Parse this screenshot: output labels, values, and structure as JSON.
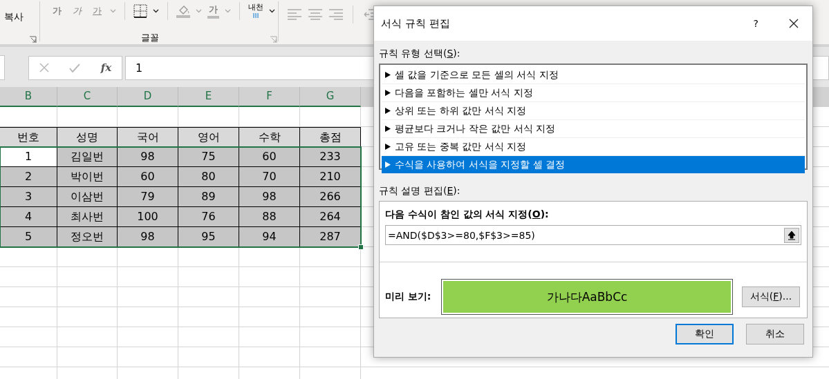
{
  "ribbon": {
    "copy_label": "복사",
    "font_buttons": [
      {
        "kind": "bold",
        "label": "가"
      },
      {
        "kind": "italic",
        "label": "가"
      },
      {
        "kind": "underline",
        "label": "가"
      }
    ],
    "font_color_label": "가",
    "phonetic_label": "내천",
    "font_group_label": "글꼴"
  },
  "formula_bar": {
    "fx": "fx",
    "value": "1"
  },
  "column_headers": [
    {
      "label": "B",
      "selected": true
    },
    {
      "label": "C",
      "selected": true
    },
    {
      "label": "D",
      "selected": true
    },
    {
      "label": "E",
      "selected": true
    },
    {
      "label": "F",
      "selected": true
    },
    {
      "label": "G",
      "selected": true
    }
  ],
  "table": {
    "columns": [
      "번호",
      "성명",
      "국어",
      "영어",
      "수학",
      "총점"
    ],
    "rows": [
      {
        "active": true,
        "cells": [
          "1",
          "김일번",
          "98",
          "75",
          "60",
          "233"
        ]
      },
      {
        "active": false,
        "cells": [
          "2",
          "박이번",
          "60",
          "80",
          "70",
          "210"
        ]
      },
      {
        "active": false,
        "cells": [
          "3",
          "이삼번",
          "79",
          "89",
          "98",
          "266"
        ]
      },
      {
        "active": false,
        "cells": [
          "4",
          "최사번",
          "100",
          "76",
          "88",
          "264"
        ]
      },
      {
        "active": false,
        "cells": [
          "5",
          "정오번",
          "98",
          "95",
          "94",
          "287"
        ]
      }
    ]
  },
  "dialog": {
    "title": "서식 규칙 편집",
    "help": "?",
    "rule_type_label": {
      "before": "규칙 유형 선택(",
      "key": "S",
      "after": "):"
    },
    "rule_types": [
      {
        "label": "셀 값을 기준으로 모든 셀의 서식 지정",
        "selected": false
      },
      {
        "label": "다음을 포함하는 셀만 서식 지정",
        "selected": false
      },
      {
        "label": "상위 또는 하위 값만 서식 지정",
        "selected": false
      },
      {
        "label": "평균보다 크거나 작은 값만 서식 지정",
        "selected": false
      },
      {
        "label": "고유 또는 중복 값만 서식 지정",
        "selected": false
      },
      {
        "label": "수식을 사용하여 서식을 지정할 셀 결정",
        "selected": true
      }
    ],
    "description_label": {
      "before": "규칙 설명 편집(",
      "key": "E",
      "after": "):"
    },
    "formula_label": {
      "before": "다음 수식이 참인 값의 서식 지정(",
      "key": "O",
      "after": "):"
    },
    "formula": "=AND($D$3>=80,$F$3>=85)",
    "preview_label": "미리 보기:",
    "preview_text": "가나다AaBbCc",
    "format_button": {
      "before": "서식(",
      "key": "F",
      "after": ")..."
    },
    "ok": "확인",
    "cancel": "취소"
  }
}
